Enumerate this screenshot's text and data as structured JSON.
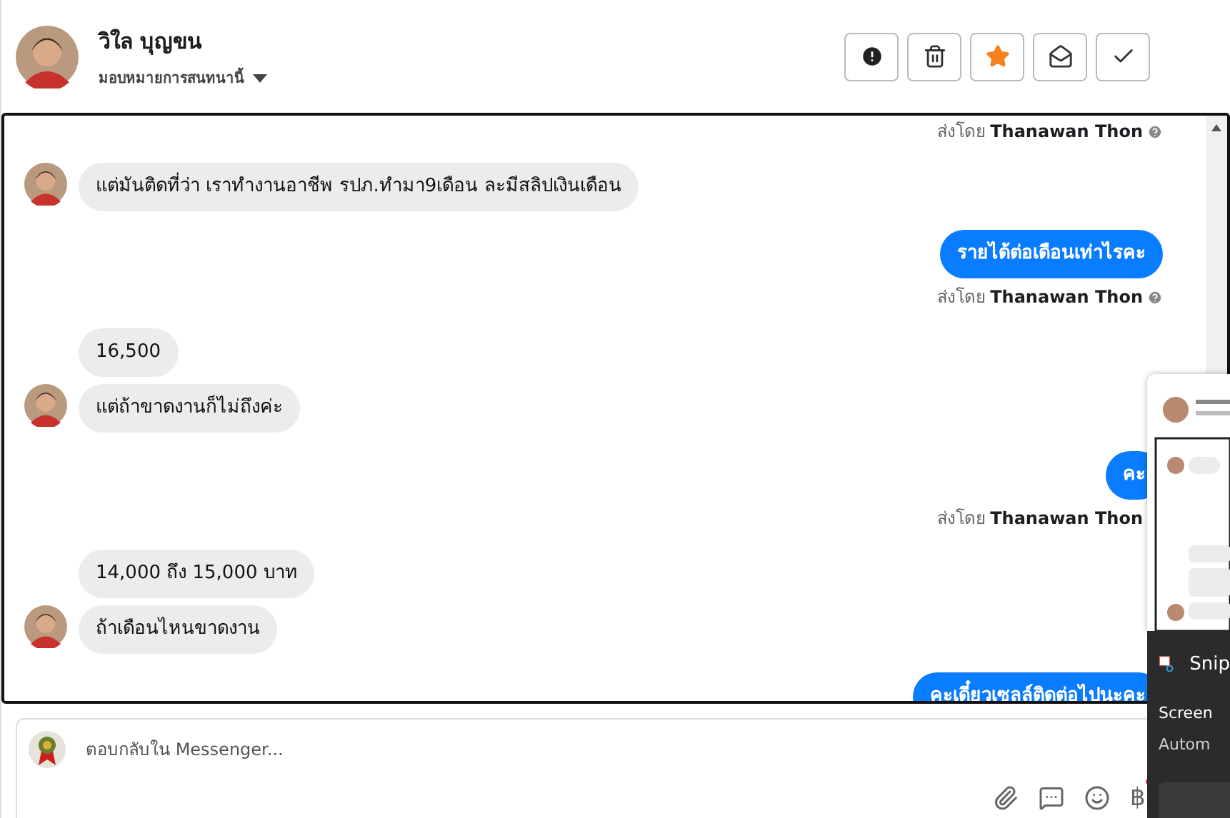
{
  "header": {
    "name": "วิใล บุญขน",
    "assign": "มอบหมายการสนทนานี้",
    "actions": [
      {
        "kind": "alert"
      },
      {
        "kind": "trash"
      },
      {
        "kind": "star"
      },
      {
        "kind": "mail"
      },
      {
        "kind": "check"
      }
    ]
  },
  "messages": [
    {
      "kind": "sent_by",
      "prefix": "ส่งโดย",
      "name": "Thanawan Thon",
      "help": true
    },
    {
      "kind": "incoming",
      "text": "แต่มันติดที่ว่า เราทำงานอาชีพ รปภ.ทำมา9เดือน ละมีสลิปเงินเดือน",
      "avatar": true
    },
    {
      "kind": "outgoing",
      "text": "รายได้ต่อเดือนเท่าไรคะ"
    },
    {
      "kind": "sent_by",
      "prefix": "ส่งโดย",
      "name": "Thanawan Thon",
      "help": true
    },
    {
      "kind": "incoming",
      "text": "16,500",
      "avatar": false
    },
    {
      "kind": "incoming",
      "text": "แต่ถ้าขาดงานก็ไม่ถึงค่ะ",
      "avatar": true
    },
    {
      "kind": "outgoing",
      "text": "คะ"
    },
    {
      "kind": "sent_by",
      "prefix": "ส่งโดย",
      "name": "Thanawan Thon",
      "help": false
    },
    {
      "kind": "incoming",
      "text": "14,000 ถึง 15,000 บาท",
      "avatar": false
    },
    {
      "kind": "incoming",
      "text": "ถ้าเดือนไหนขาดงาน",
      "avatar": true
    },
    {
      "kind": "outgoing",
      "text": "คะเดี๋ยวเซลล์ติดต่อไปนะคะ"
    }
  ],
  "composer": {
    "placeholder": "ตอบกลับใน Messenger...",
    "tools": [
      {
        "kind": "attach"
      },
      {
        "kind": "comment"
      },
      {
        "kind": "emoji"
      },
      {
        "kind": "currency",
        "symbol": "฿"
      }
    ]
  },
  "notification": {
    "app": "Snip",
    "lines": [
      "Screen",
      "Autom"
    ]
  }
}
